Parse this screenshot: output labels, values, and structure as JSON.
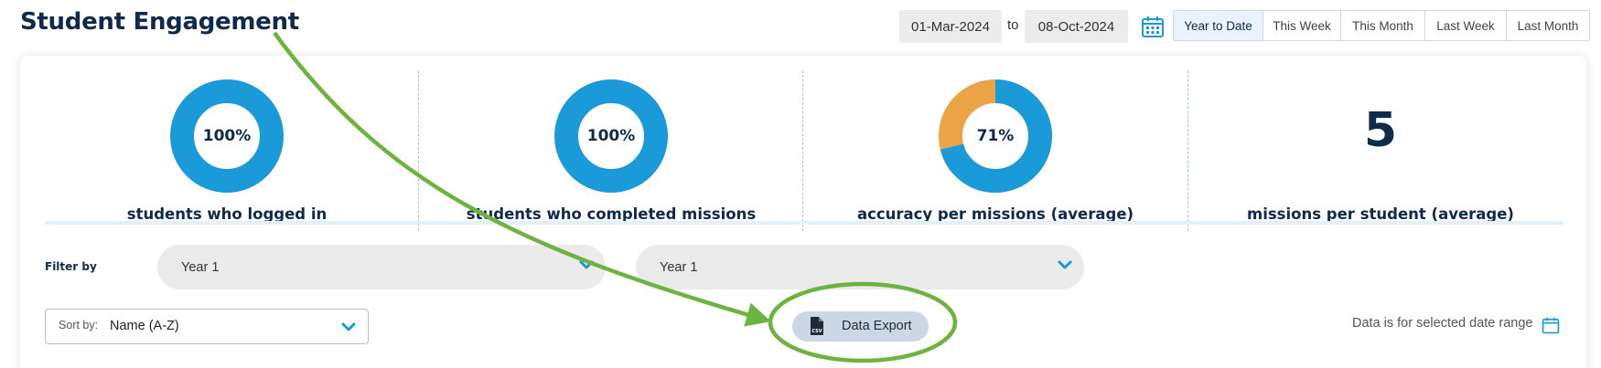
{
  "page": {
    "title": "Student Engagement"
  },
  "date_range": {
    "start": "01-Mar-2024",
    "separator": "to",
    "end": "08-Oct-2024",
    "presets": [
      "Year to Date",
      "This Week",
      "This Month",
      "Last Week",
      "Last Month"
    ],
    "active_preset": "Year to Date"
  },
  "stats": [
    {
      "value_text": "100%",
      "percent": 100,
      "label": "students who logged in"
    },
    {
      "value_text": "100%",
      "percent": 100,
      "label": "students who completed missions"
    },
    {
      "value_text": "71%",
      "percent": 71,
      "label": "accuracy per missions (average)"
    },
    {
      "value_text": "5",
      "label": "missions per student (average)"
    }
  ],
  "filters": {
    "label": "Filter by",
    "selects": [
      {
        "value": "Year 1"
      },
      {
        "value": "Year 1"
      }
    ]
  },
  "sort": {
    "prefix": "Sort by:",
    "value": "Name (A-Z)"
  },
  "export": {
    "label": "Data Export",
    "icon": "csv-file-icon"
  },
  "note": {
    "text": "Data is for selected date range"
  },
  "colors": {
    "primary_blue": "#1a9ad8",
    "secondary_orange": "#eba445",
    "navy": "#0f2a4a",
    "annotation_green": "#6db33f"
  }
}
